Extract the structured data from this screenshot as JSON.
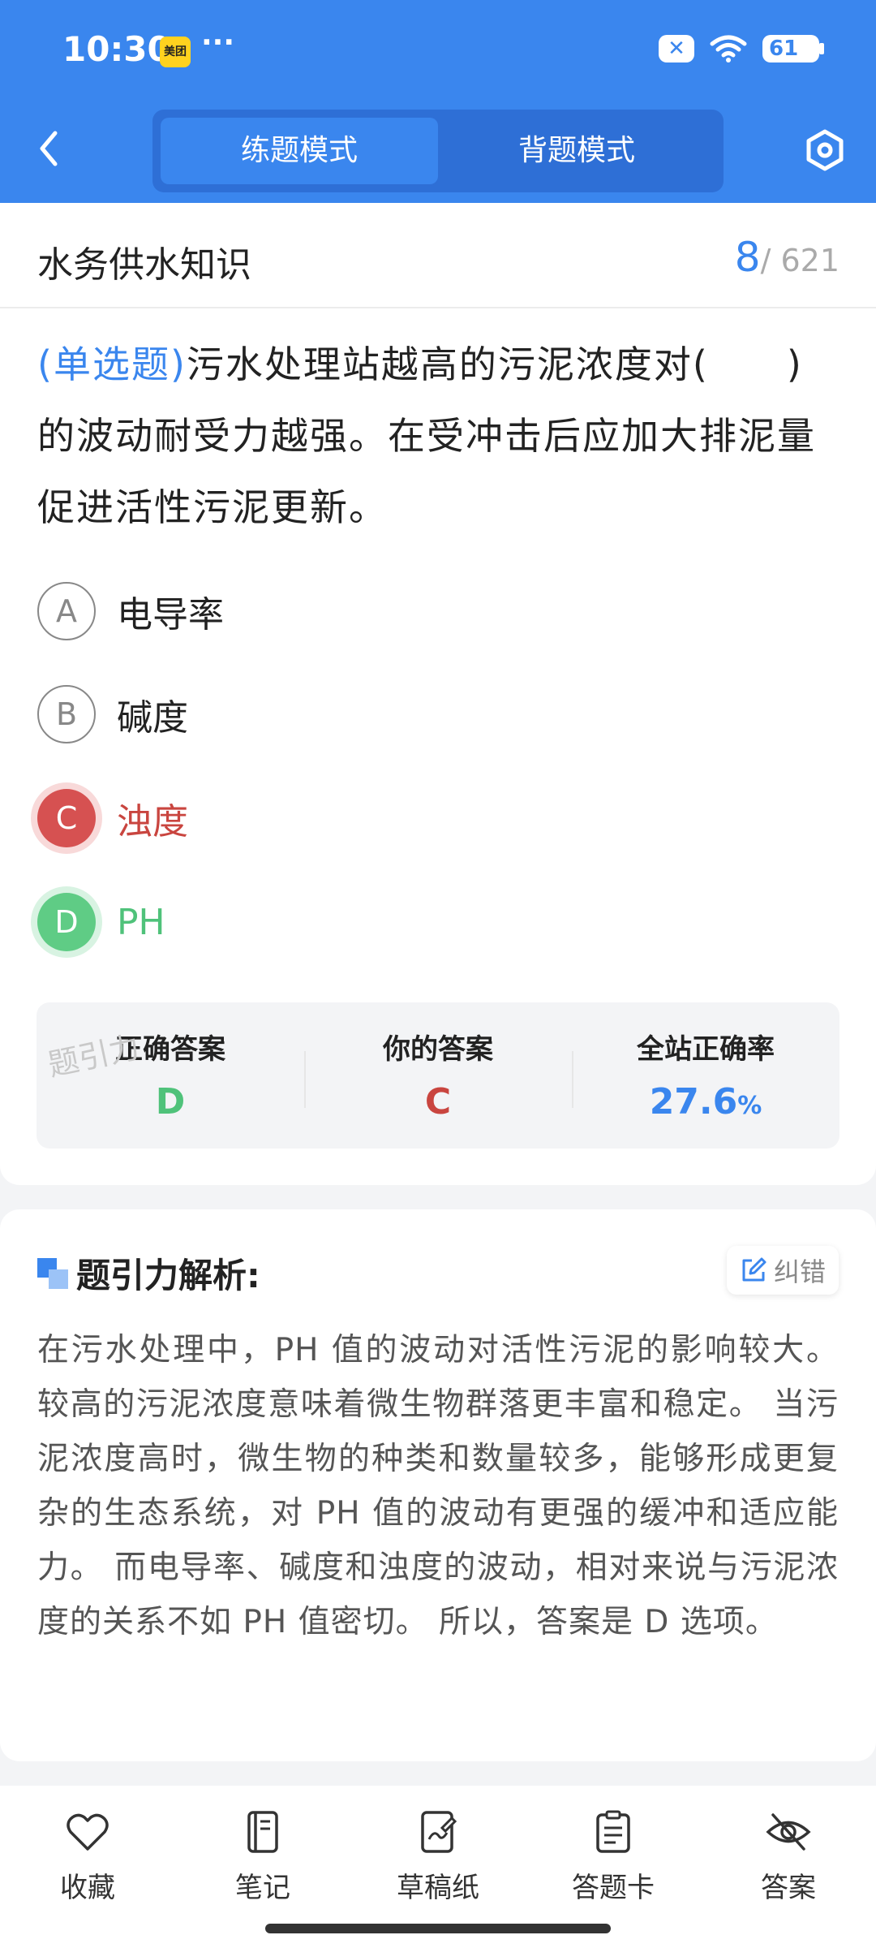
{
  "status_bar": {
    "time": "10:30",
    "app_badge": "美团",
    "dots": "···",
    "battery": "61"
  },
  "header": {
    "tabs": [
      {
        "label": "练题模式",
        "active": true
      },
      {
        "label": "背题模式",
        "active": false
      }
    ]
  },
  "question_card": {
    "category": "水务供水知识",
    "current": "8",
    "total": "/ 621",
    "question_type": "(单选题)",
    "question_text": "污水处理站越高的污泥浓度对(　　)的波动耐受力越强。在受冲击后应加大排泥量促进活性污泥更新。",
    "options": [
      {
        "letter": "A",
        "text": "电导率",
        "state": "normal"
      },
      {
        "letter": "B",
        "text": "碱度",
        "state": "normal"
      },
      {
        "letter": "C",
        "text": "浊度",
        "state": "wrong"
      },
      {
        "letter": "D",
        "text": "PH",
        "state": "correct"
      }
    ],
    "result": {
      "correct_label": "正确答案",
      "correct_value": "D",
      "yours_label": "你的答案",
      "yours_value": "C",
      "rate_label": "全站正确率",
      "rate_value": "27.6",
      "rate_unit": "%"
    },
    "watermark": "题引力"
  },
  "analysis": {
    "title": "题引力解析:",
    "fix_label": "纠错",
    "body": "在污水处理中，PH 值的波动对活性污泥的影响较大。较高的污泥浓度意味着微生物群落更丰富和稳定。 当污泥浓度高时，微生物的种类和数量较多，能够形成更复杂的生态系统，对 PH 值的波动有更强的缓冲和适应能力。 而电导率、碱度和浊度的波动，相对来说与污泥浓度的关系不如 PH 值密切。 所以，答案是 D 选项。"
  },
  "bottom_bar": [
    {
      "label": "收藏",
      "icon": "heart-icon"
    },
    {
      "label": "笔记",
      "icon": "notebook-icon"
    },
    {
      "label": "草稿纸",
      "icon": "draft-icon"
    },
    {
      "label": "答题卡",
      "icon": "answer-card-icon"
    },
    {
      "label": "答案",
      "icon": "eye-off-icon"
    }
  ],
  "colors": {
    "primary": "#3a86ee",
    "correct": "#4fc27a",
    "wrong": "#c9453f"
  }
}
